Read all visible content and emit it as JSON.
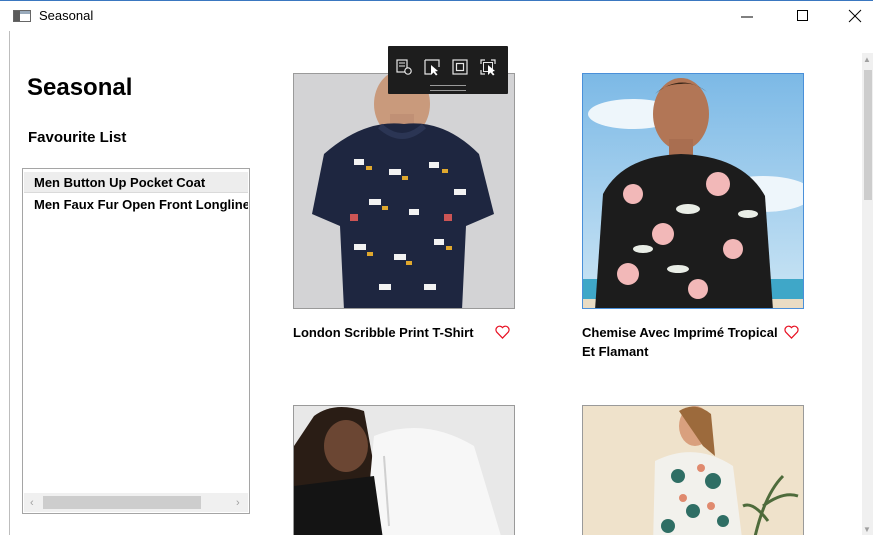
{
  "window": {
    "title": "Seasonal",
    "minimize_glyph": "—",
    "maximize_glyph": "□",
    "close_glyph": "✕"
  },
  "debug_toolbar": {
    "buttons": [
      "visual-tree-icon",
      "select-element-icon",
      "display-layout-adorners-icon",
      "track-focused-element-icon"
    ]
  },
  "header": {
    "title": "Seasonal"
  },
  "favourites": {
    "title": "Favourite List",
    "items": [
      {
        "label": "Men Button Up Pocket Coat",
        "selected": true
      },
      {
        "label": "Men Faux Fur Open Front Longline Coat",
        "selected": false
      }
    ],
    "scroll_left": "‹",
    "scroll_right": "›"
  },
  "products": [
    {
      "title": "London Scribble Print T-Shirt",
      "favourited": false
    },
    {
      "title": "Chemise Avec Imprimé Tropical Et Flamant",
      "favourited": false
    },
    {
      "title": "",
      "favourited": false
    },
    {
      "title": "",
      "favourited": false
    }
  ],
  "colors": {
    "heart": "#e81123",
    "selection_border": "#4a90d9",
    "title_bar_accent": "#3a77c0"
  }
}
